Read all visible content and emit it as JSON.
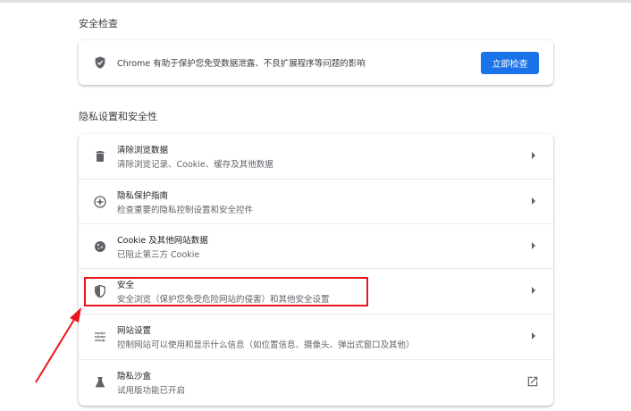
{
  "safety_check": {
    "title": "安全检查",
    "description": "Chrome 有助于保护您免受数据泄露、不良扩展程序等问题的影响",
    "button": "立即检查"
  },
  "privacy": {
    "title": "隐私设置和安全性",
    "items": [
      {
        "title": "清除浏览数据",
        "subtitle": "清除浏览记录、Cookie、缓存及其他数据",
        "icon": "trash-icon"
      },
      {
        "title": "隐私保护指南",
        "subtitle": "检查重要的隐私控制设置和安全控件",
        "icon": "compass-icon"
      },
      {
        "title": "Cookie 及其他网站数据",
        "subtitle": "已阻止第三方 Cookie",
        "icon": "cookie-icon"
      },
      {
        "title": "安全",
        "subtitle": "安全浏览（保护您免受危险网站的侵害）和其他安全设置",
        "icon": "shield-icon"
      },
      {
        "title": "网站设置",
        "subtitle": "控制网站可以使用和显示什么信息（如位置信息、摄像头、弹出式窗口及其他）",
        "icon": "tune-icon"
      },
      {
        "title": "隐私沙盒",
        "subtitle": "试用版功能已开启",
        "icon": "flask-icon"
      }
    ]
  },
  "annotation_color": "#e8151b"
}
